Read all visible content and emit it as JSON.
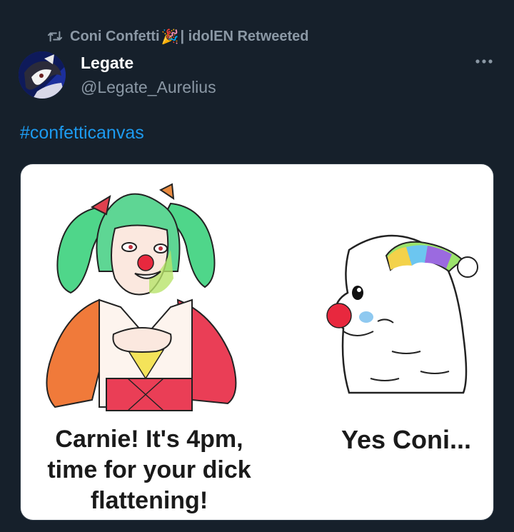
{
  "retweet": {
    "icon": "retweet-icon",
    "text_before_emoji": "Coni Confetti ",
    "emoji": "🎉",
    "text_after_emoji": "| idolEN Retweeted"
  },
  "tweet": {
    "display_name": "Legate",
    "handle": "@Legate_Aurelius",
    "hashtag": "#confetticanvas",
    "more_icon": "more-dots-icon"
  },
  "media": {
    "caption_left": "Carnie! It's 4pm, time for your dick flattening!",
    "caption_right": "Yes Coni..."
  },
  "colors": {
    "background": "#16202b",
    "link": "#1d9bf0",
    "muted": "#8b98a5",
    "text": "#e7e9ea"
  }
}
